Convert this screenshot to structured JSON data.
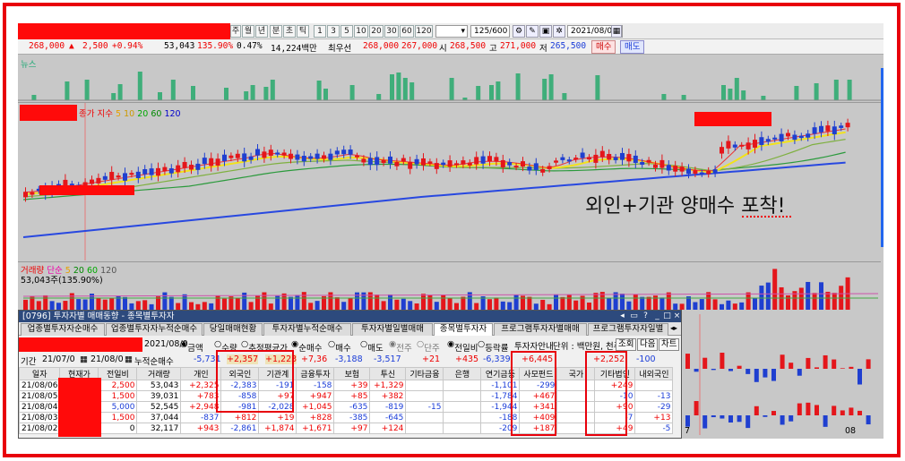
{
  "toolbar": {
    "period_buttons": [
      "주",
      "월",
      "년",
      "분",
      "초",
      "틱"
    ],
    "interval_buttons": [
      "1",
      "3",
      "5",
      "10",
      "20",
      "30",
      "60",
      "120"
    ],
    "count": "125/600",
    "date": "2021/08/06",
    "price": "268,000",
    "change_arrow": "▲",
    "change": "2,500",
    "change_pct": "+0.94%",
    "volume": "53,043",
    "vol_ratio": "135.90%",
    "turnover_pct": "0.47%",
    "amount": "14,224백만",
    "best_label": "최우선",
    "ask1": "268,000",
    "bid1": "267,000",
    "open_label": "시",
    "open": "268,500",
    "high_label": "고",
    "high": "271,000",
    "low_label": "저",
    "low": "265,500",
    "buy_label": "매수",
    "sell_label": "매도"
  },
  "news_label": "뉴스",
  "price_panel_label": "종가 지수 5 10 20 60 120",
  "ma_labels": [
    "종가 지수",
    "5",
    "10",
    "20",
    "60",
    "120"
  ],
  "volume_panel": {
    "label": "거래량 단순 5 20 60 120",
    "name": "거래량",
    "ma_labels": [
      "단순",
      "5",
      "20",
      "60",
      "120"
    ],
    "value": "53,043주(135.90%)"
  },
  "annotation": "외인+기관 양매수 포착!",
  "window": {
    "title": "[0796] 투자자별 매매동향 - 종목별투자자",
    "tabs": [
      "업종별투자자순매수",
      "업종별투자자누적순매수",
      "당일매매현황",
      "투자자별누적순매수",
      "투자자별일별매매",
      "종목별투자자",
      "프로그램투자자별매매",
      "프로그램투자자일별"
    ],
    "active_tab": "종목별투자자",
    "date_field": "2021/08/0",
    "opt_amount": "금액",
    "opt_qty": "수량",
    "opt_avg": "추정평균가",
    "opt_net": "순매수",
    "opt_buy": "매수",
    "opt_sell": "매도",
    "opt_prev": "전주",
    "opt_ratio": "단주",
    "opt_dayratio": "전일비",
    "opt_updown": "등락률",
    "opt_investor": "투자자안내",
    "unit": "단위 : 백만원, 천주",
    "btn_query": "조회",
    "btn_next": "다음",
    "btn_chart": "차트",
    "period_label": "기간",
    "from": "21/07/0",
    "to": "21/08/0",
    "cum_label": "누적순매수",
    "sums": [
      "-5,731",
      "+2,357",
      "+1,223",
      "+7,36",
      "-3,188",
      "-3,517",
      "+21",
      "+435",
      "-6,339",
      "+6,445",
      "",
      "+2,252",
      "-100"
    ],
    "headers": [
      "일자",
      "현재가",
      "전일비",
      "거래량",
      "개인",
      "외국인",
      "기관계",
      "금융투자",
      "보험",
      "투신",
      "기타금융",
      "은행",
      "연기금등",
      "사모펀드",
      "국가",
      "기타법인",
      "내외국인"
    ],
    "rows": [
      [
        "21/08/06",
        "",
        "2,500",
        "53,043",
        "+2,325",
        "-2,383",
        "-191",
        "-158",
        "+39",
        "+1,329",
        "",
        "",
        "-1,101",
        "-299",
        "",
        "+249",
        ""
      ],
      [
        "21/08/05",
        "",
        "1,500",
        "39,031",
        "+783",
        "-858",
        "+97",
        "+947",
        "+85",
        "+382",
        "",
        "",
        "-1,784",
        "+467",
        "",
        "-10",
        "-13"
      ],
      [
        "21/08/04",
        "",
        "5,000",
        "52,545",
        "+2,948",
        "-981",
        "-2,028",
        "+1,045",
        "-635",
        "-819",
        "-15",
        "",
        "-1,944",
        "+341",
        "",
        "+90",
        "-29"
      ],
      [
        "21/08/03",
        "",
        "1,500",
        "37,044",
        "-837",
        "+812",
        "+19",
        "+828",
        "-385",
        "-645",
        "",
        "",
        "-188",
        "+409",
        "",
        "-7",
        "+13"
      ],
      [
        "21/08/02",
        "",
        "0",
        "32,117",
        "+943",
        "-2,861",
        "+1,874",
        "+1,671",
        "+97",
        "+124",
        "",
        "",
        "-209",
        "+187",
        "",
        "+49",
        "-5"
      ]
    ]
  },
  "right_axis": {
    "mid_label": "7",
    "right_label": "08"
  }
}
